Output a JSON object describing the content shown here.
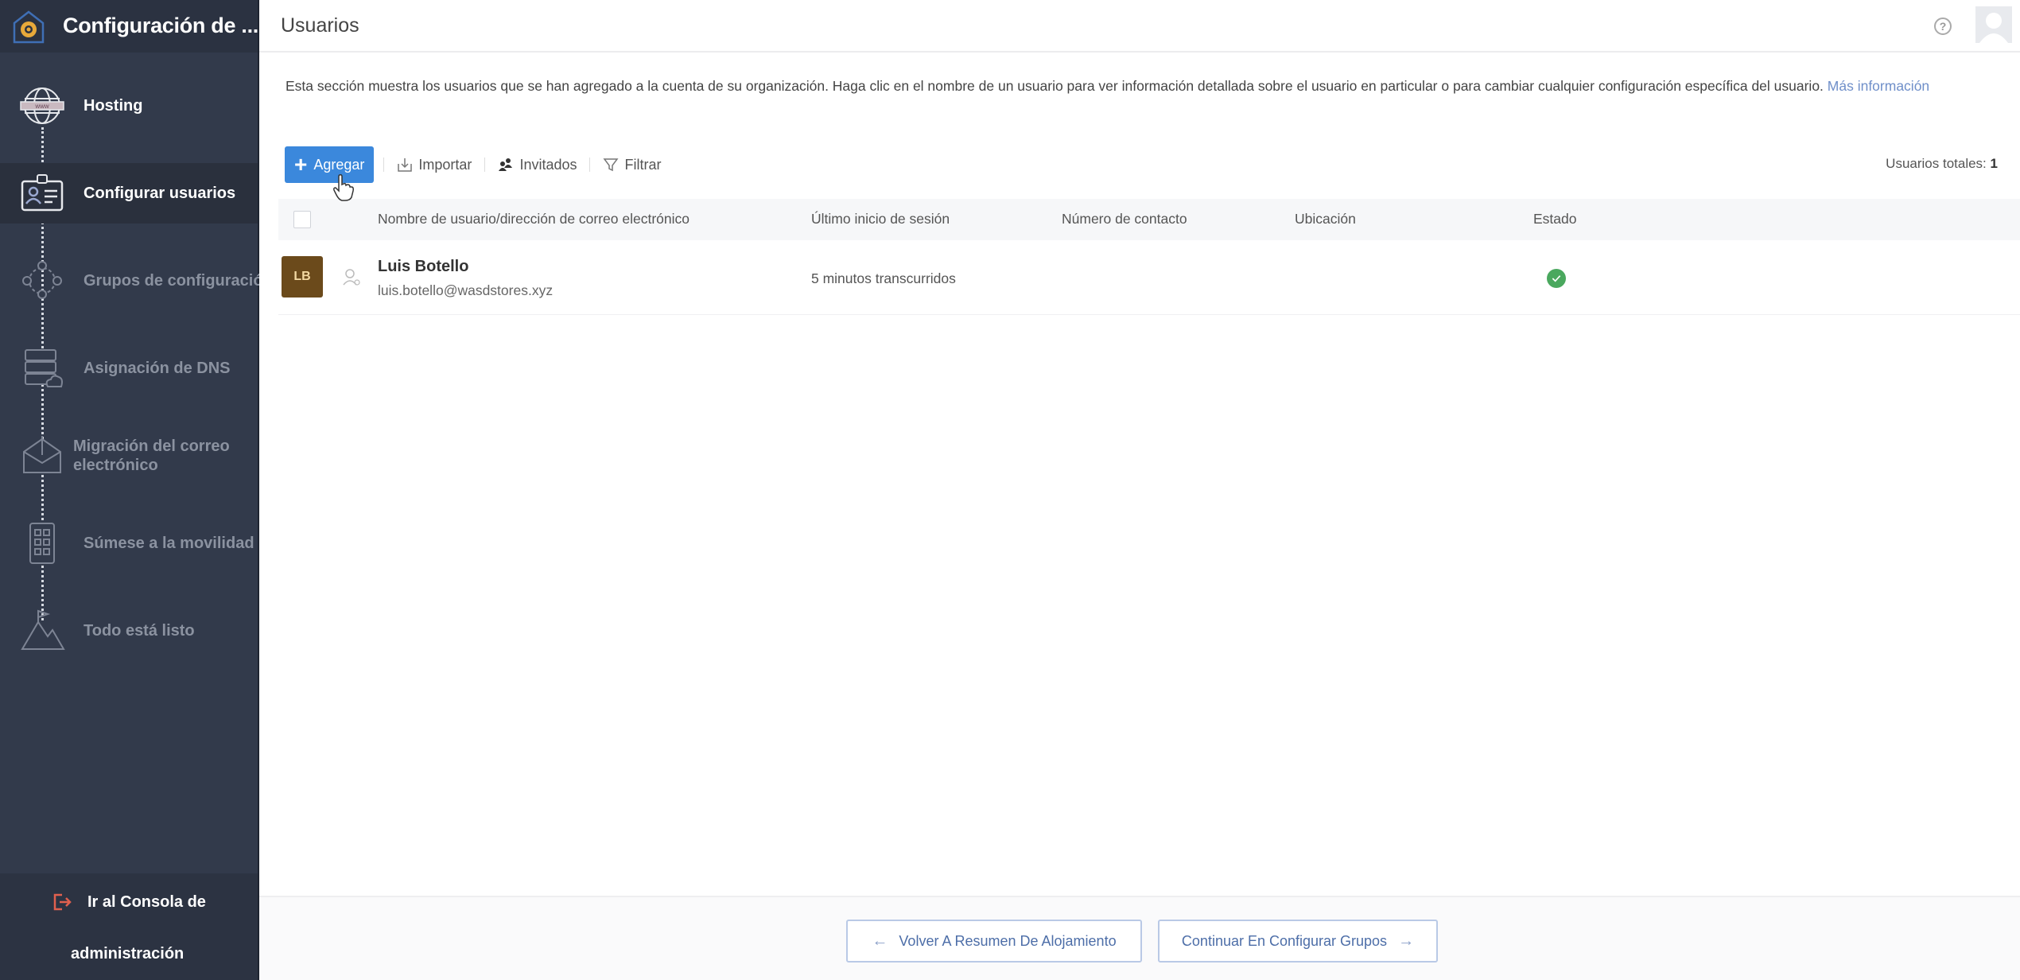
{
  "sidebar": {
    "title": "Configuración de ...",
    "items": [
      {
        "label": "Hosting",
        "icon": "globe-www-icon",
        "state": "done"
      },
      {
        "label": "Configurar usuarios",
        "icon": "id-card-icon",
        "state": "active"
      },
      {
        "label": "Grupos de configuración",
        "icon": "group-icon",
        "state": "pending"
      },
      {
        "label": "Asignación de DNS",
        "icon": "dns-server-icon",
        "state": "pending"
      },
      {
        "label": "Migración del correo",
        "label2": "electrónico",
        "icon": "mail-migration-icon",
        "state": "pending"
      },
      {
        "label": "Súmese a la movilidad",
        "icon": "mobile-apps-icon",
        "state": "pending"
      },
      {
        "label": "Todo está listo",
        "icon": "mountain-flag-icon",
        "state": "pending"
      }
    ],
    "admin_link": {
      "line1": "Ir al Consola de",
      "line2": "administración",
      "icon": "exit-icon"
    }
  },
  "header": {
    "title": "Usuarios",
    "help_icon": "help-icon",
    "avatar_icon": "user-avatar-icon"
  },
  "description": {
    "text": "Esta sección muestra los usuarios que se han agregado a la cuenta de su organización. Haga clic en el nombre de un usuario para ver información detallada sobre el usuario en particular o para cambiar cualquier configuración específica del usuario. ",
    "link": "Más información"
  },
  "toolbar": {
    "add_label": "Agregar",
    "import_label": "Importar",
    "invited_label": "Invitados",
    "filter_label": "Filtrar",
    "total_label": "Usuarios totales:",
    "total_value": "1"
  },
  "table": {
    "columns": [
      "Nombre de usuario/dirección de correo electrónico",
      "Último inicio de sesión",
      "Número de contacto",
      "Ubicación",
      "Estado"
    ],
    "rows": [
      {
        "initials": "LB",
        "name": "Luis Botello",
        "email": "luis.botello@wasdstores.xyz",
        "last_login": "5 minutos transcurridos",
        "contact": "",
        "location": "",
        "status": "active",
        "avatar_color": "#6b4a1b"
      }
    ]
  },
  "footer": {
    "back_label": "Volver A Resumen De Alojamiento",
    "next_label": "Continuar En Configurar Grupos"
  },
  "colors": {
    "accent": "#3b88dc",
    "sidebar_bg": "#323a4b",
    "status_ok": "#4aa85e",
    "link": "#6f8fc9"
  }
}
